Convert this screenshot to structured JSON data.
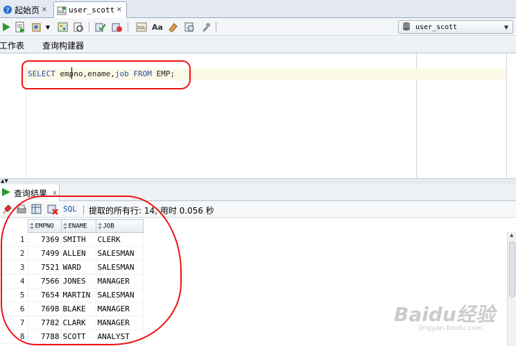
{
  "tabs": [
    {
      "label": "起始页",
      "active": false
    },
    {
      "label": "user_scott",
      "active": true
    }
  ],
  "toolbar": {
    "connection": "user_scott",
    "icons": [
      "run-statement-icon",
      "run-script-icon",
      "autotrace-icon",
      "commit-icon",
      "rollback-icon",
      "unshared-worksheet-icon",
      "sql-history-icon",
      "to-upper-icon",
      "eraser-icon",
      "sql-tuning-icon"
    ]
  },
  "subtabs": [
    "工作表",
    "查询构建器"
  ],
  "editor": {
    "kw_select": "SELECT",
    "cols_part1": " emp",
    "cols_part2": "no,ename,",
    "kw_job": "job",
    "space": " ",
    "kw_from": "FROM",
    "table_part": " EMP;"
  },
  "results": {
    "tab_label": "查询结果",
    "sql_link": "SQL",
    "status": "提取的所有行: 14, 用时 0.056 秒",
    "columns": [
      "EMPNO",
      "ENAME",
      "JOB"
    ],
    "rows": [
      {
        "n": "1",
        "empno": "7369",
        "ename": "SMITH",
        "job": "CLERK"
      },
      {
        "n": "2",
        "empno": "7499",
        "ename": "ALLEN",
        "job": "SALESMAN"
      },
      {
        "n": "3",
        "empno": "7521",
        "ename": "WARD",
        "job": "SALESMAN"
      },
      {
        "n": "4",
        "empno": "7566",
        "ename": "JONES",
        "job": "MANAGER"
      },
      {
        "n": "5",
        "empno": "7654",
        "ename": "MARTIN",
        "job": "SALESMAN"
      },
      {
        "n": "6",
        "empno": "7698",
        "ename": "BLAKE",
        "job": "MANAGER"
      },
      {
        "n": "7",
        "empno": "7782",
        "ename": "CLARK",
        "job": "MANAGER"
      },
      {
        "n": "8",
        "empno": "7788",
        "ename": "SCOTT",
        "job": "ANALYST"
      }
    ]
  },
  "watermark": {
    "brand": "Baidu经验",
    "url": "jingyan.baidu.com"
  }
}
